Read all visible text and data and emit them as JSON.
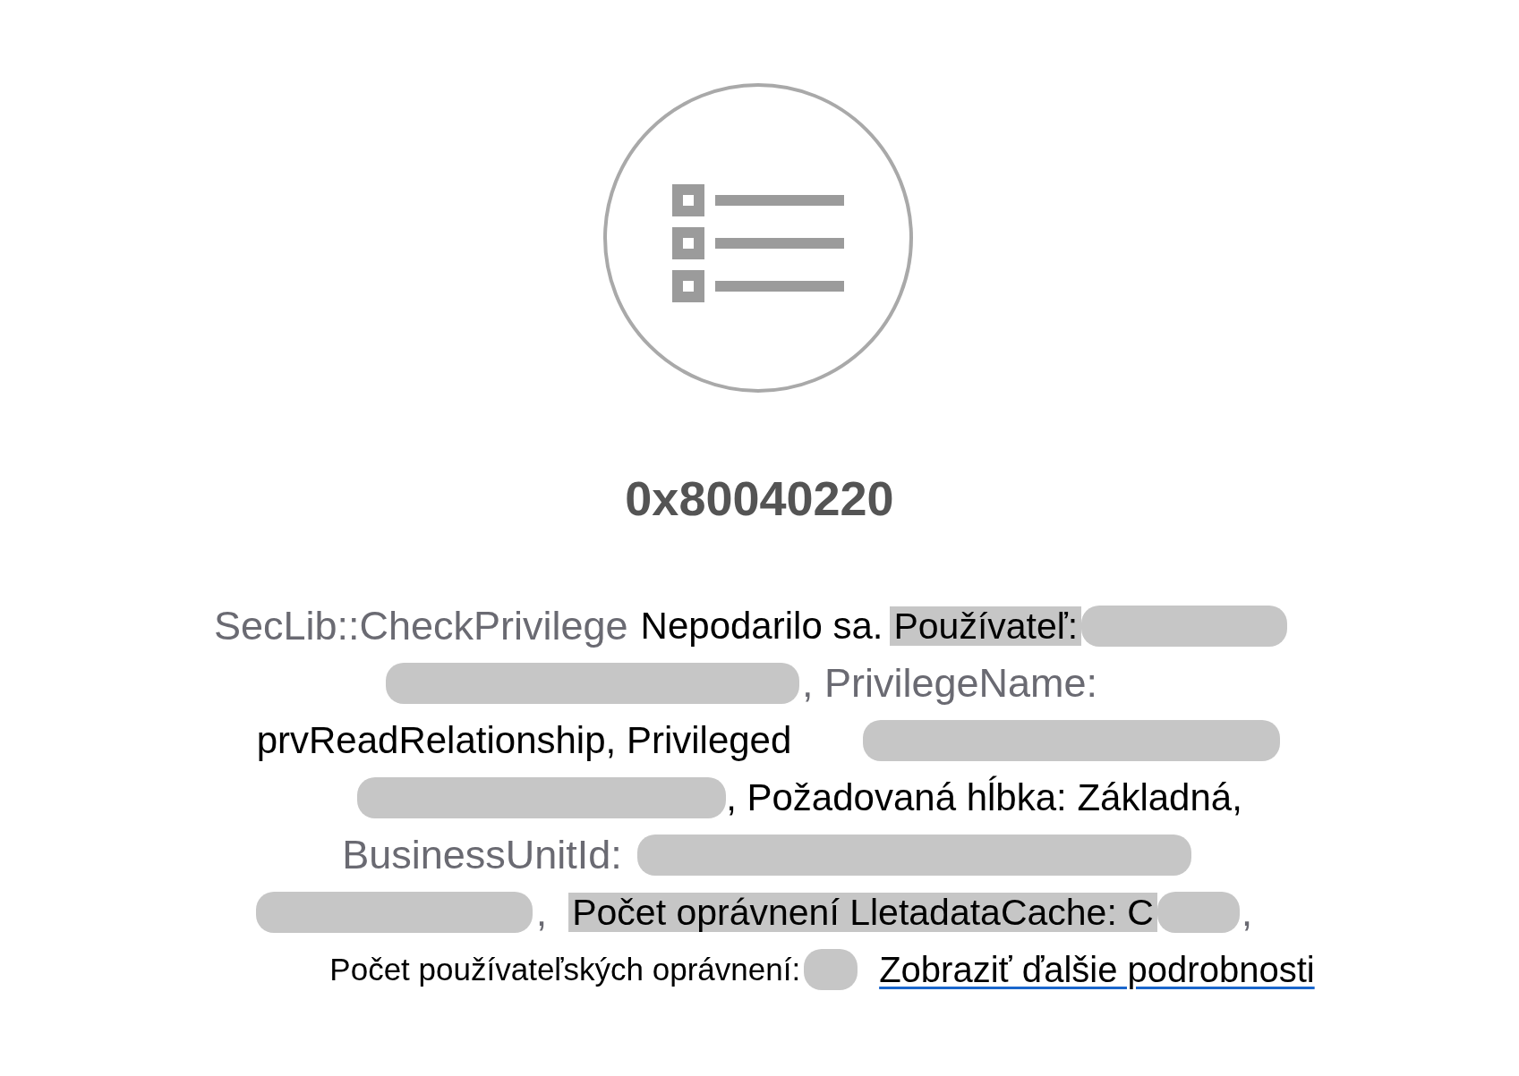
{
  "error_code": "0x80040220",
  "message_lines": [
    {
      "segments": [
        {
          "kind": "faded",
          "text": "SecLib::CheckPrivilege"
        },
        {
          "kind": "plain",
          "text": "Nepodarilo sa."
        },
        {
          "kind": "shaded",
          "text": "Používateľ:"
        },
        {
          "kind": "redacted"
        }
      ]
    },
    {
      "segments": [
        {
          "kind": "redacted"
        },
        {
          "kind": "faded",
          "text": ", PrivilegeName:"
        }
      ]
    },
    {
      "segments": [
        {
          "kind": "plain",
          "text": "prvReadRelationship, Privileged"
        },
        {
          "kind": "redacted"
        }
      ]
    },
    {
      "segments": [
        {
          "kind": "redacted"
        },
        {
          "kind": "plain",
          "text": ", Požadovaná hĺbka: Základná,"
        }
      ]
    },
    {
      "segments": [
        {
          "kind": "faded",
          "text": "BusinessUnitId:"
        },
        {
          "kind": "redacted"
        }
      ]
    },
    {
      "segments": [
        {
          "kind": "redacted"
        },
        {
          "kind": "faded",
          "text": ","
        },
        {
          "kind": "shaded",
          "text": "Počet oprávnení LletadataCache: C"
        },
        {
          "kind": "redacted"
        },
        {
          "kind": "faded",
          "text": ","
        }
      ]
    },
    {
      "segments": [
        {
          "kind": "plain",
          "text": "Počet používateľských oprávnení:"
        },
        {
          "kind": "redacted"
        },
        {
          "kind": "link",
          "text": "Zobraziť ďalšie podrobnosti"
        }
      ]
    }
  ]
}
